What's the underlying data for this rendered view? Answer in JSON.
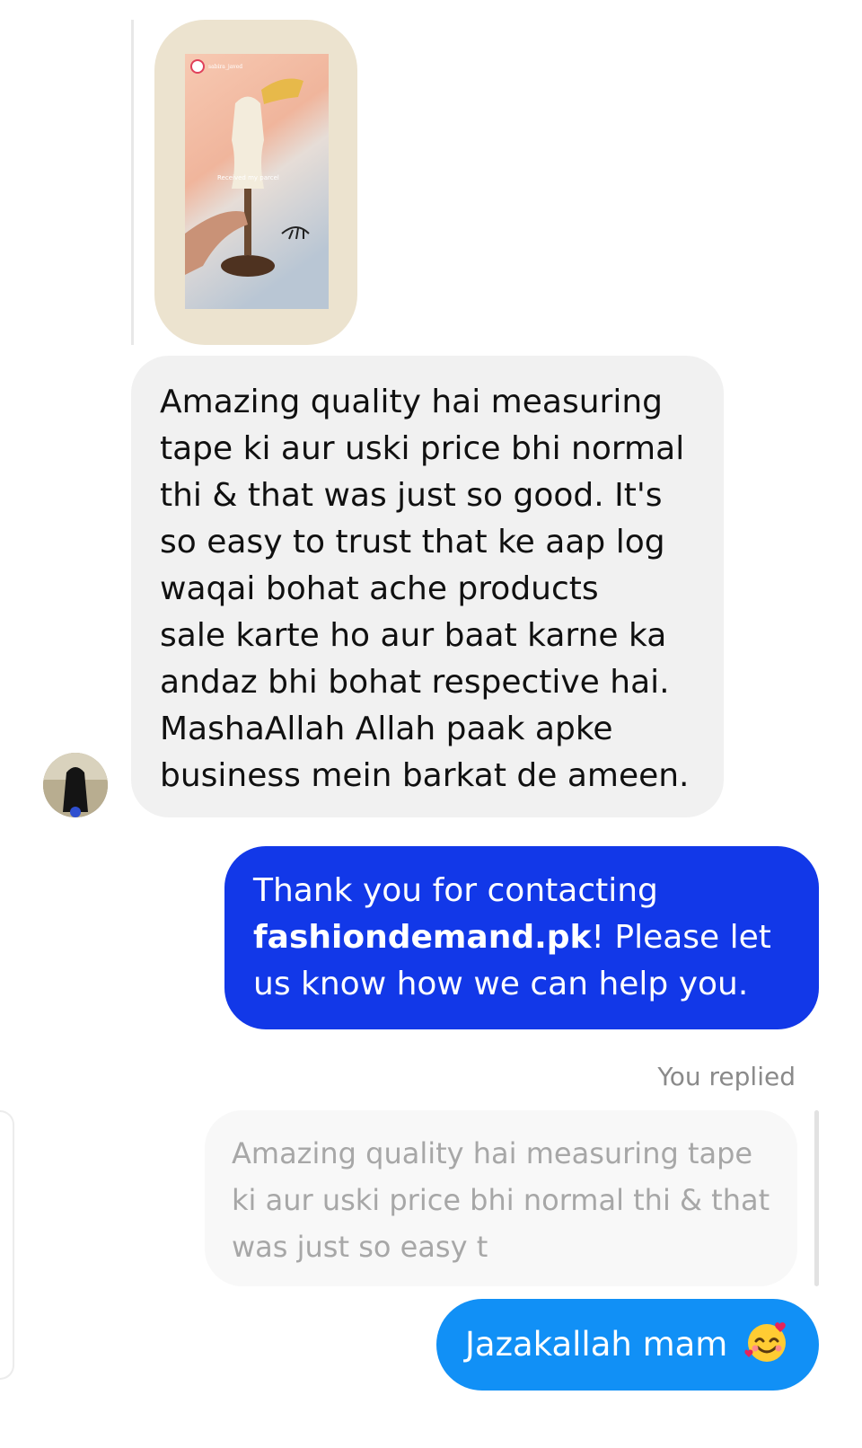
{
  "story": {
    "username": "sabira_javed",
    "caption": "Received my parcel"
  },
  "incoming_message": {
    "text": "Amazing quality hai measuring\ntape ki aur uski price bhi normal\nthi & that was just so good. It's\nso easy to trust that ke aap log\nwaqai bohat ache products\nsale karte ho aur baat karne ka\nandaz bhi bohat respective hai.\nMashaAllah Allah paak apke\nbusiness mein barkat de ameen."
  },
  "outgoing_greeting": {
    "prefix": "Thank you for contacting ",
    "brand": "fashiondemand.pk",
    "suffix": "! Please let us know how we can help you."
  },
  "reply_context": {
    "label": "You replied",
    "quoted_text": "Amazing quality hai measuring tape ki aur uski price bhi normal thi & that was just so easy t"
  },
  "outgoing_reply": {
    "text": "Jazakallah mam",
    "emoji": "smiling-face-with-hearts"
  },
  "colors": {
    "greeting_bubble": "#1238e8",
    "reply_bubble": "#1190f6",
    "incoming_bubble": "#f1f1f1"
  }
}
